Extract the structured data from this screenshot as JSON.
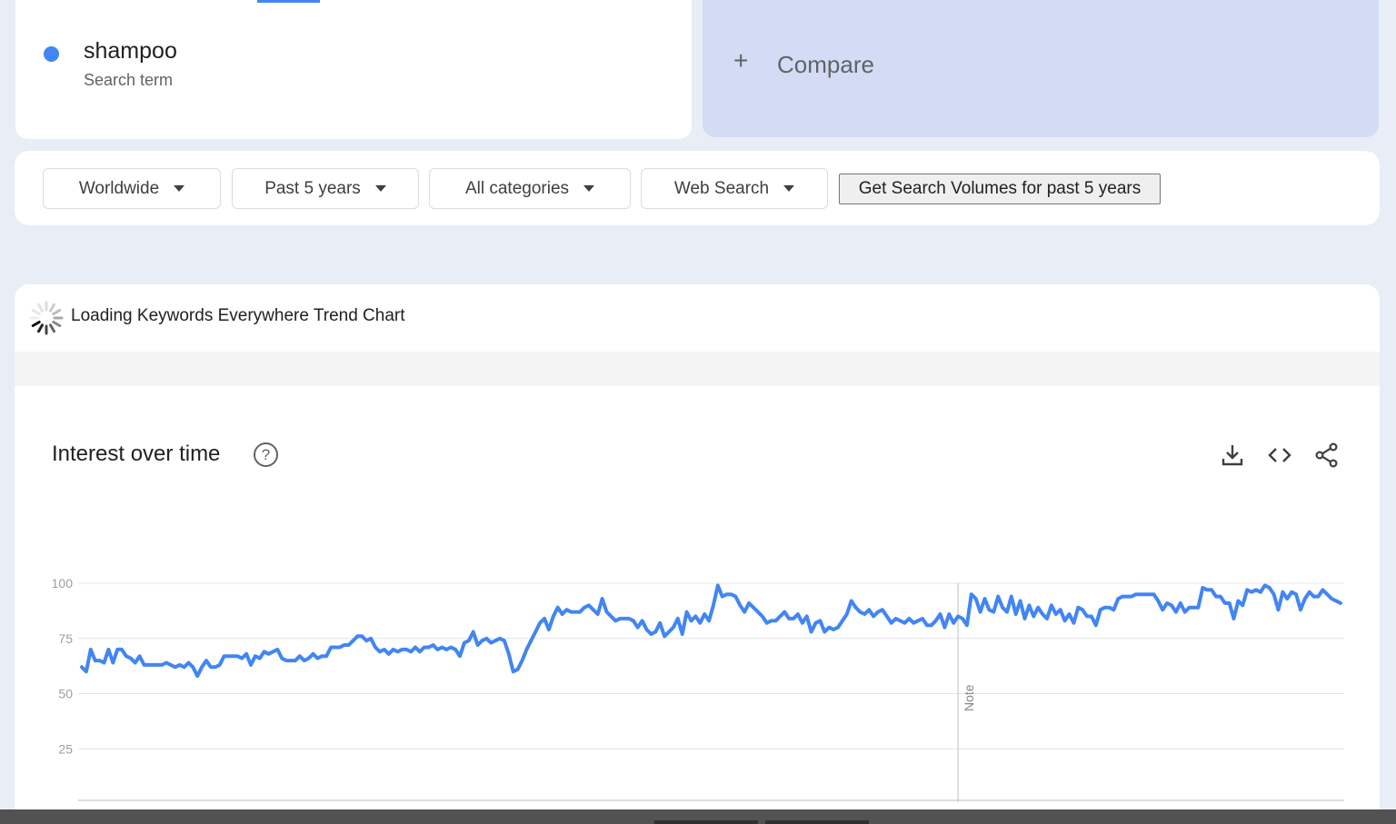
{
  "search_term": {
    "name": "shampoo",
    "type": "Search term",
    "color": "#4285f4"
  },
  "compare": {
    "label": "Compare",
    "icon": "plus-icon"
  },
  "filters": [
    {
      "label": "Worldwide"
    },
    {
      "label": "Past 5 years"
    },
    {
      "label": "All categories"
    },
    {
      "label": "Web Search"
    }
  ],
  "volume_button": {
    "label": "Get Search Volumes for past 5 years"
  },
  "keywords_everywhere": {
    "label": "Loading Keywords Everywhere Trend Chart"
  },
  "chart_card": {
    "title": "Interest over time",
    "help": "?",
    "actions": [
      "download-icon",
      "embed-code-icon",
      "share-icon"
    ]
  },
  "chart_data": {
    "type": "line",
    "ylim": [
      0,
      100
    ],
    "yticks": [
      25,
      50,
      75,
      100
    ],
    "annotation": "Note",
    "annotation_week": 197,
    "series": [
      {
        "color": "#4285f4",
        "values": [
          62,
          60,
          70,
          65,
          65,
          64,
          70,
          64,
          70,
          70,
          67,
          66,
          64,
          67,
          63,
          63,
          63,
          63,
          63,
          64,
          63,
          62,
          63,
          62,
          64,
          62,
          58,
          62,
          65,
          62,
          62,
          63,
          67,
          67,
          67,
          67,
          66,
          68,
          63,
          67,
          66,
          69,
          68,
          69,
          70,
          66,
          65,
          65,
          65,
          67,
          65,
          66,
          68,
          66,
          67,
          67,
          71,
          71,
          71,
          72,
          72,
          74,
          76,
          76,
          74,
          75,
          71,
          69,
          70,
          68,
          70,
          69,
          70,
          70,
          69,
          71,
          69,
          71,
          71,
          72,
          70,
          71,
          70,
          71,
          70,
          67,
          73,
          74,
          78,
          72,
          74,
          75,
          73,
          74,
          75,
          74,
          68,
          60,
          61,
          65,
          70,
          74,
          78,
          82,
          84,
          79,
          85,
          89,
          86,
          88,
          87,
          87,
          87,
          89,
          90,
          88,
          86,
          93,
          87,
          85,
          83,
          84,
          84,
          84,
          83,
          80,
          83,
          79,
          77,
          78,
          82,
          76,
          78,
          80,
          84,
          77,
          87,
          83,
          85,
          82,
          86,
          83,
          90,
          99,
          94,
          95,
          95,
          94,
          90,
          87,
          91,
          89,
          87,
          85,
          82,
          83,
          83,
          85,
          87,
          84,
          84,
          86,
          82,
          85,
          78,
          82,
          83,
          78,
          80,
          79,
          80,
          83,
          86,
          92,
          89,
          87,
          86,
          88,
          85,
          87,
          88,
          85,
          82,
          84,
          83,
          82,
          84,
          82,
          83,
          84,
          81,
          81,
          83,
          86,
          80,
          86,
          82,
          85,
          84,
          81,
          95,
          93,
          87,
          93,
          88,
          87,
          94,
          89,
          87,
          94,
          86,
          92,
          84,
          90,
          85,
          89,
          86,
          84,
          90,
          86,
          88,
          83,
          86,
          82,
          89,
          88,
          85,
          85,
          81,
          88,
          89,
          89,
          88,
          93,
          94,
          94,
          94,
          95,
          95,
          95,
          95,
          95,
          92,
          88,
          91,
          90,
          87,
          91,
          87,
          89,
          89,
          89,
          98,
          97,
          97,
          94,
          94,
          91,
          91,
          84,
          92,
          90,
          97,
          96,
          97,
          96,
          99,
          98,
          95,
          88,
          96,
          93,
          96,
          95,
          88,
          93,
          96,
          94,
          94,
          97,
          95,
          93,
          92,
          91
        ]
      }
    ]
  }
}
